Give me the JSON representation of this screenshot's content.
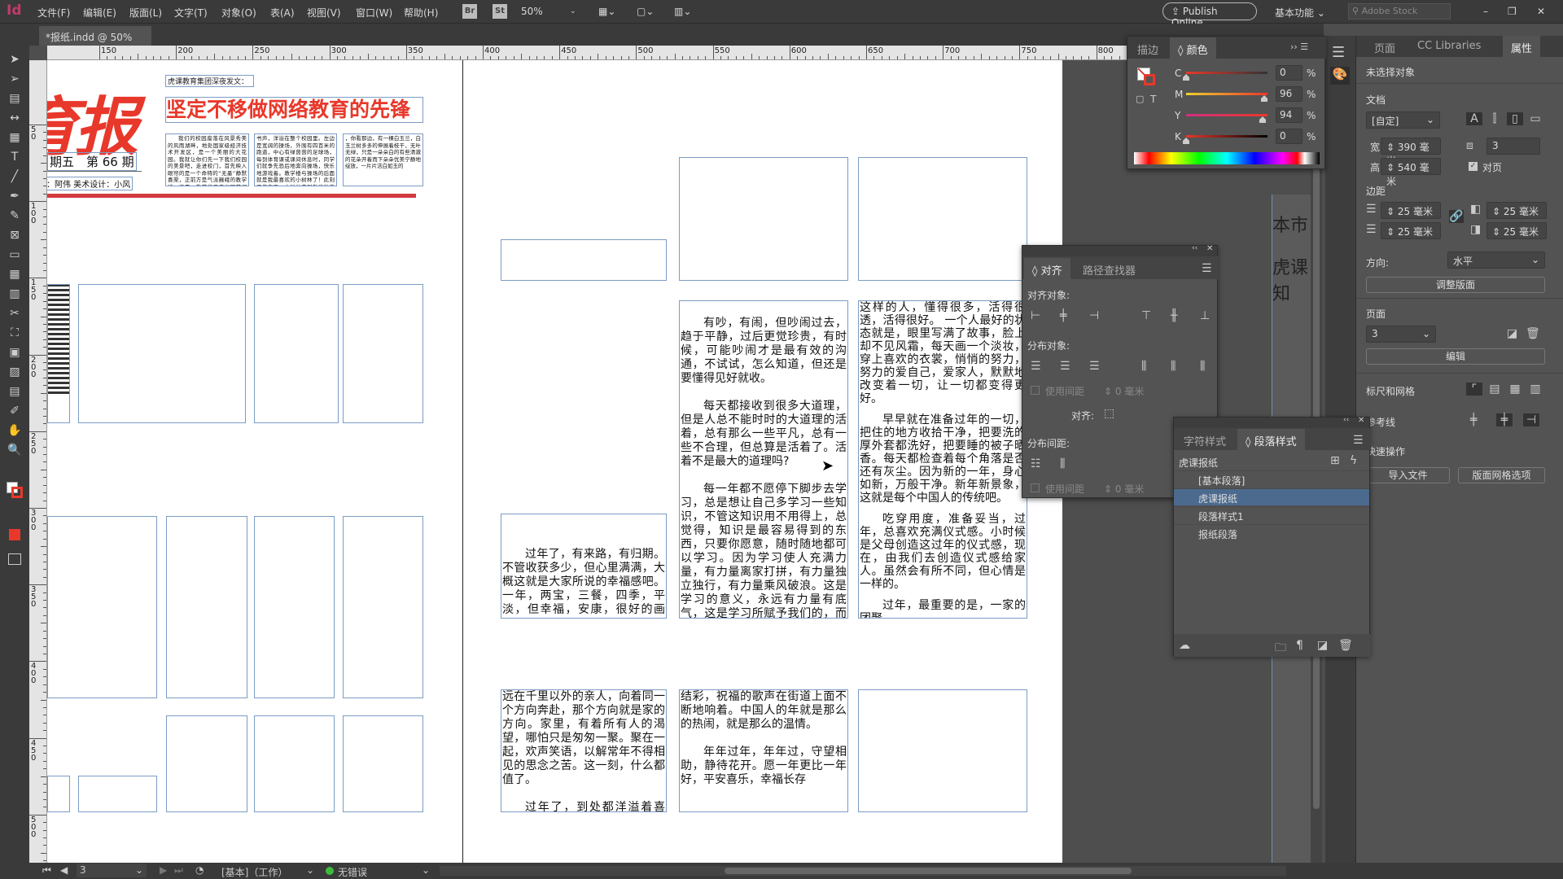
{
  "app": {
    "logo": "Id",
    "menu": [
      "文件(F)",
      "编辑(E)",
      "版面(L)",
      "文字(T)",
      "对象(O)",
      "表(A)",
      "视图(V)",
      "窗口(W)",
      "帮助(H)"
    ],
    "bridge": "Br",
    "stock": "St",
    "zoom": "50%",
    "publish": "Publish Online",
    "workspace": "基本功能",
    "search_placeholder": "Adobe Stock"
  },
  "document_tab": {
    "title": "*报纸.indd @ 50%",
    "close": "×"
  },
  "rulers": {
    "horizontal": [
      150,
      200,
      250,
      300,
      350,
      400,
      450,
      500,
      550,
      600,
      650,
      700,
      750,
      800
    ],
    "vertical": [
      50,
      100,
      150,
      200,
      250,
      300,
      350,
      400,
      450,
      500
    ]
  },
  "tools": [
    "selection-tool",
    "direct-selection-tool",
    "page-tool",
    "gap-tool",
    "content-collector-tool",
    "type-tool",
    "line-tool",
    "pen-tool",
    "pencil-tool",
    "rectangle-frame-tool",
    "rectangle-tool",
    "table-tool",
    "grid-tool",
    "scissors-tool",
    "free-transform-tool",
    "gradient-swatch-tool",
    "gradient-feather-tool",
    "note-tool",
    "eyedropper-tool",
    "hand-tool",
    "zoom-tool"
  ],
  "tool_glyphs": [
    "➤",
    "➢",
    "▤",
    "↔",
    "▦",
    "T",
    "╱",
    "✒",
    "✎",
    "⊠",
    "▭",
    "▦",
    "▥",
    "✂",
    "⛶",
    "▣",
    "▨",
    "▤",
    "✐",
    "✋",
    "🔍"
  ],
  "left_page": {
    "masthead": "育报",
    "issue": "期五　第 66 期",
    "credits": "编：阿伟  美术设计：小风",
    "kicker": "虎课教育集团深夜发文：",
    "headline": "坚定不移做网络教育的先锋",
    "columns": [
      "我们的校园座落在风景秀美的风雨湖畔，地处国家级经济技术开发区，是一个美丽的大花园。我就让你们先一下我们校园的美景吧，走进校门，首先映入眼帘的是一个命特的“无墨”静默喜渠，正前方是气派巍峨的教学楼，清晨，教学楼里传出同学们朗朗的读",
      "书声，洋溢在整个校园里。左边是宽阔的操场，外围有四百米的跑道，中心有绿茵茵的足球场，每到体育课或课间休息时，同学们就争先恐后地奔向操场，快乐地游戏着。教学楼与操场的后面就是我最喜欢的小树林了！此刻正值春天，小树林内到处洋溢着春天的气息",
      "，你看那边，有一棵白玉兰，白玉兰树多多的伸展着枝干，无叶无绿，只是一朵朵白的有些清澈的花朵开着而下朵朵优美宁静地绽放，一片片洁白如玉的"
    ]
  },
  "right_page": {
    "frame_d": [
      "过年了，有来路，有归期。不管收获多少，但心里满满，大概这就是大家所说的幸福感吧。一年，两宝，三餐，四季，平淡，但幸福，安康，很好的画面。"
    ],
    "frame_e": [
      "有吵，有闹，但吵闹过去，趋于平静，过后更觉珍贵，有时候，可能吵闹才是最有效的沟通，不试试，怎么知道，但还是要懂得见好就收。",
      "每天都接收到很多大道理，但是人总不能时时的大道理的活着，总有那么一些平凡，总有一些不合理，但总算是活着了。活着不是最大的道理吗?",
      "每一年都不愿停下脚步去学习，总是想让自己多学习一些知识，不管这知识用不用得上，总觉得，知识是最容易得到的东西，只要你愿意，随时随地都可以学习。因为学习使人充满力量，有力量离家打拼，有力量独立独行，有力量乘风破浪。这是学习的意义，永远有力量有底气，这是学习所赋予我们的，而谁也没有办法拿走。腹有诗书气自华，一直都努力要成为"
    ],
    "frame_f": [
      "这样的人，懂得很多，活得很透，活得很好。 一个人最好的状态就是，眼里写满了故事，脸上却不见风霜，每天画一个淡妆，穿上喜欢的衣裳，悄悄的努力，努力的爱自己，爱家人，默默地改变着一切，让一切都变得更好。",
      "早早就在准备过年的一切，把住的地方收拾干净，把要洗的厚外套都洗好，把要睡的被子晒香。每天都检查着每个角落是否还有灰尘。因为新的一年，身心如新，万般干净。新年新景象，这就是每个中国人的传统吧。",
      "吃穿用度，准备妥当，过年，总喜欢充满仪式感。小时候是父母创造这过年的仪式感，现在，由我们去创造仪式感给家人。虽然会有所不同，但心情是一样的。",
      "过年，最重要的是，一家的团聚。"
    ],
    "frame_g": [
      "远在千里以外的亲人，向着同一个方向奔赴，那个方向就是家的方向。家里，有着所有人的渴望，哪怕只是匆匆一聚。聚在一起，欢声笑语，以解常年不得相见的思念之苦。这一刻，什么都值了。",
      "过年了，到处都洋溢着喜气，张灯"
    ],
    "frame_h": [
      "结彩，祝福的歌声在街道上面不断地响着。中国人的年就是那么的热闹，就是那么的温情。",
      "年年过年，年年过，守望相助，静待花开。愿一年更比一年好，平安喜乐，幸福长存"
    ]
  },
  "next_page_text": [
    "本市",
    "虎课",
    "知"
  ],
  "color_panel": {
    "tabs": [
      "描边",
      "颜色"
    ],
    "channels": [
      {
        "label": "C",
        "value": "0",
        "pct": 0
      },
      {
        "label": "M",
        "value": "96",
        "pct": 96
      },
      {
        "label": "Y",
        "value": "94",
        "pct": 94
      },
      {
        "label": "K",
        "value": "0",
        "pct": 0
      }
    ],
    "unit": "%",
    "fill_color": "#e8382b"
  },
  "align_panel": {
    "tabs": [
      "对齐",
      "路径查找器"
    ],
    "align_objects": "对齐对象:",
    "distribute_objects": "分布对象:",
    "use_spacing": "使用间距",
    "spacing_value": "0 毫米",
    "align_to": "对齐:",
    "distribute_spacing": "分布间距:"
  },
  "para_panel": {
    "tabs": [
      "字符样式",
      "段落样式"
    ],
    "group": "虎课报纸",
    "items": [
      "[基本段落]",
      "虎课报纸",
      "段落样式1",
      "报纸段落"
    ],
    "selected": 1
  },
  "properties": {
    "tabs": [
      "页面",
      "CC Libraries",
      "属性"
    ],
    "no_selection": "未选择对象",
    "document": "文档",
    "preset": "[自定]",
    "width_label": "宽",
    "width": "390 毫米",
    "height_label": "高",
    "height": "540 毫米",
    "pages_count": "3",
    "facing_pages": "对页",
    "facing_checked": true,
    "margins": "边距",
    "margin_values": [
      "25 毫米",
      "25 毫米",
      "25 毫米",
      "25 毫米"
    ],
    "orientation_label": "方向:",
    "orientation": "水平",
    "adjust_layout": "调整版面",
    "page_label": "页面",
    "page": "3",
    "edit": "编辑",
    "rulers_grids": "标尺和网格",
    "guides": "参考线",
    "quick_actions": "快速操作",
    "import_file": "导入文件",
    "layout_grid": "版面网格选项"
  },
  "status": {
    "page": "3",
    "profile": "[基本]（工作）",
    "preflight": "无错误",
    "preflight_color": "#3dbb3d"
  }
}
